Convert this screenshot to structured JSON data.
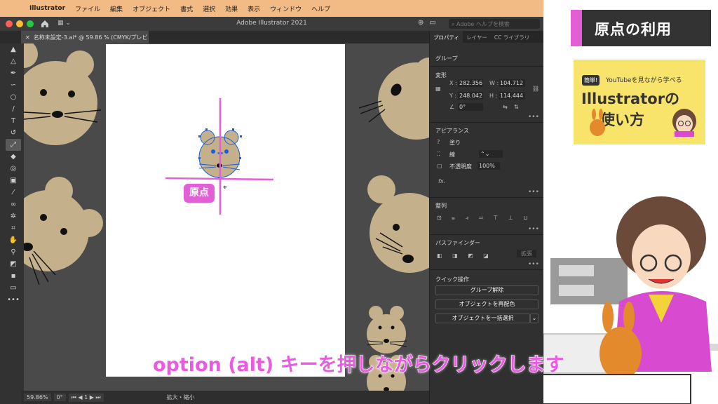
{
  "menubar": {
    "app": "Illustrator",
    "items": [
      "ファイル",
      "編集",
      "オブジェクト",
      "書式",
      "選択",
      "効果",
      "表示",
      "ウィンドウ",
      "ヘルプ"
    ]
  },
  "window": {
    "title": "Adobe Illustrator 2021",
    "search_placeholder": "Adobe ヘルプを検索",
    "doc_tab": "名称未設定-3.ai* @ 59.86 % (CMYK/プレビュー)"
  },
  "panel": {
    "tabs": [
      "プロパティ",
      "レイヤー",
      "CC ライブラリ"
    ],
    "group_label": "グループ",
    "transform": {
      "title": "変形",
      "x_label": "X :",
      "x": "282.356",
      "y_label": "Y :",
      "y": "248.042",
      "w_label": "W :",
      "w": "104.712",
      "h_label": "H :",
      "h": "114.444",
      "angle": "0°"
    },
    "appearance": {
      "title": "アピアランス",
      "fill": "塗り",
      "stroke": "線",
      "opacity_label": "不透明度",
      "opacity": "100%",
      "fx": "fx."
    },
    "align": {
      "title": "整列"
    },
    "pathfinder": {
      "title": "パスファインダー",
      "expand": "拡張"
    },
    "quick": {
      "title": "クイック操作",
      "buttons": [
        "グループ解除",
        "オブジェクトを再配色",
        "オブジェクトを一括選択"
      ]
    }
  },
  "status": {
    "zoom": "59.86%",
    "angle": "0°",
    "page": "1",
    "mode": "拡大・縮小"
  },
  "overlay": {
    "section_title": "原点の利用",
    "card_badge": "簡単!",
    "card_sub": "YouTubeを見ながら学べる",
    "card_line1": "Illustratorの",
    "card_line2": "使い方",
    "origin_label": "原点",
    "caption": "option (alt) キーを押しながらクリックします"
  },
  "colors": {
    "accent": "#e35fd6",
    "mouse": "#c4b08b",
    "menubar": "#f2bb86",
    "card": "#f8e36b"
  }
}
